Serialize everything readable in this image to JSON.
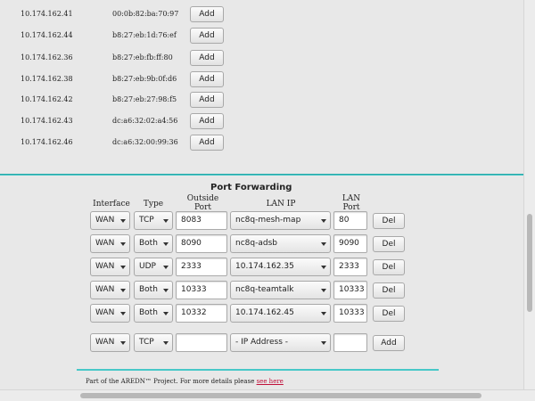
{
  "leases": [
    {
      "ip": "10.174.162.41",
      "mac": "00:0b:82:ba:70:97",
      "add_label": "Add"
    },
    {
      "ip": "10.174.162.44",
      "mac": "b8:27:eb:1d:76:ef",
      "add_label": "Add"
    },
    {
      "ip": "10.174.162.36",
      "mac": "b8:27:eb:fb:ff:80",
      "add_label": "Add"
    },
    {
      "ip": "10.174.162.38",
      "mac": "b8:27:eb:9b:0f:d6",
      "add_label": "Add"
    },
    {
      "ip": "10.174.162.42",
      "mac": "b8:27:eb:27:98:f5",
      "add_label": "Add"
    },
    {
      "ip": "10.174.162.43",
      "mac": "dc:a6:32:02:a4:56",
      "add_label": "Add"
    },
    {
      "ip": "10.174.162.46",
      "mac": "dc:a6:32:00:99:36",
      "add_label": "Add"
    }
  ],
  "port_forwarding": {
    "title": "Port Forwarding",
    "headers": {
      "interface": "Interface",
      "type": "Type",
      "outside_port_1": "Outside",
      "outside_port_2": "Port",
      "lan_ip": "LAN IP",
      "lan_port_1": "LAN",
      "lan_port_2": "Port"
    },
    "rules": [
      {
        "interface": "WAN",
        "type": "TCP",
        "outside_port": "8083",
        "lan_ip": "nc8q-mesh-map",
        "lan_port": "80",
        "del_label": "Del"
      },
      {
        "interface": "WAN",
        "type": "Both",
        "outside_port": "8090",
        "lan_ip": "nc8q-adsb",
        "lan_port": "9090",
        "del_label": "Del"
      },
      {
        "interface": "WAN",
        "type": "UDP",
        "outside_port": "2333",
        "lan_ip": "10.174.162.35",
        "lan_port": "2333",
        "del_label": "Del"
      },
      {
        "interface": "WAN",
        "type": "Both",
        "outside_port": "10333",
        "lan_ip": "nc8q-teamtalk",
        "lan_port": "10333",
        "del_label": "Del"
      },
      {
        "interface": "WAN",
        "type": "Both",
        "outside_port": "10332",
        "lan_ip": "10.174.162.45",
        "lan_port": "10333",
        "del_label": "Del"
      }
    ],
    "new_rule": {
      "interface": "WAN",
      "type": "TCP",
      "outside_port": "",
      "lan_ip": "- IP Address -",
      "lan_port": "",
      "add_label": "Add"
    }
  },
  "footer": {
    "text": "Part of the AREDN™ Project. For more details please ",
    "link_text": "see here"
  },
  "colors": {
    "accent_rule": "#48c8c8",
    "link": "#c0103a"
  }
}
